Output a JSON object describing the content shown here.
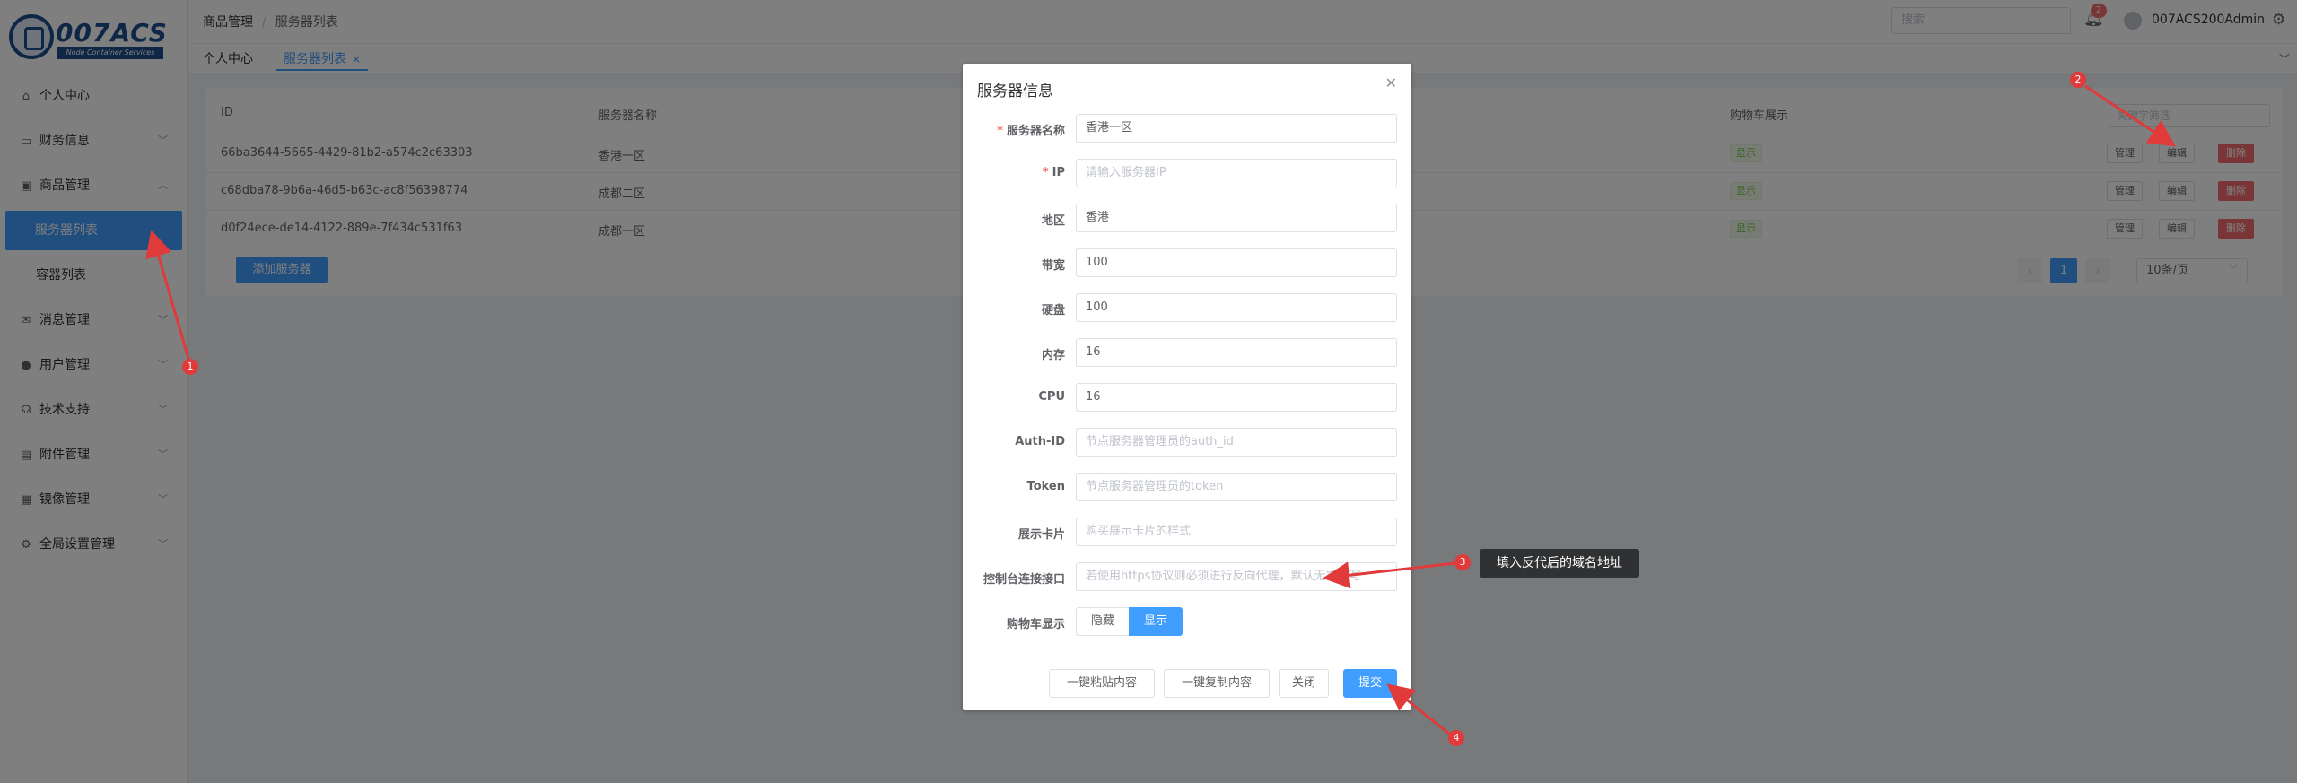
{
  "brand": {
    "logo_text": "007ACS",
    "logo_sub": "Node Container Services"
  },
  "sidebar": {
    "items": [
      {
        "label": "个人中心",
        "icon": "home-icon",
        "glyph": "⌂",
        "chevron": false
      },
      {
        "label": "财务信息",
        "icon": "wallet-icon",
        "glyph": "▭",
        "chevron": true
      },
      {
        "label": "商品管理",
        "icon": "bag-icon",
        "glyph": "▣",
        "chevron": true,
        "expanded": true
      },
      {
        "label": "消息管理",
        "icon": "message-icon",
        "glyph": "✉",
        "chevron": true
      },
      {
        "label": "用户管理",
        "icon": "user-icon",
        "glyph": "●",
        "chevron": true
      },
      {
        "label": "技术支持",
        "icon": "headset-icon",
        "glyph": "☊",
        "chevron": true
      },
      {
        "label": "附件管理",
        "icon": "folder-icon",
        "glyph": "▤",
        "chevron": true
      },
      {
        "label": "镜像管理",
        "icon": "box-icon",
        "glyph": "▦",
        "chevron": true
      },
      {
        "label": "全局设置管理",
        "icon": "settings-icon",
        "glyph": "⚙",
        "chevron": true
      }
    ],
    "sub_items": [
      "服务器列表",
      "容器列表"
    ]
  },
  "header": {
    "breadcrumb": [
      "商品管理",
      "服务器列表"
    ],
    "breadcrumb_sep": "/",
    "search_placeholder": "搜索",
    "notif_count": "2",
    "user_name": "007ACS200Admin"
  },
  "tabs": [
    {
      "label": "个人中心"
    },
    {
      "label": "服务器列表",
      "close": "×"
    }
  ],
  "table": {
    "headers": {
      "id": "ID",
      "name": "服务器名称",
      "cart": "购物车展示"
    },
    "filter_placeholder": "关键字筛选",
    "rows": [
      {
        "id": "66ba3644-5665-4429-81b2-a574c2c63303",
        "name": "香港一区",
        "cart": "显示"
      },
      {
        "id": "c68dba78-9b6a-46d5-b63c-ac8f56398774",
        "name": "成都二区",
        "cart": "显示"
      },
      {
        "id": "d0f24ece-de14-4122-889e-7f434c531f63",
        "name": "成都一区",
        "cart": "显示"
      }
    ],
    "actions": {
      "manage": "管理",
      "edit": "编辑",
      "delete": "删除"
    },
    "add_button": "添加服务器",
    "pager": {
      "current": "1",
      "size": "10条/页"
    }
  },
  "dialog": {
    "title": "服务器信息",
    "fields": [
      {
        "label": "服务器名称",
        "required": true,
        "value": "香港一区",
        "placeholder": ""
      },
      {
        "label": "IP",
        "required": true,
        "value": "",
        "placeholder": "请输入服务器IP"
      },
      {
        "label": "地区",
        "required": false,
        "value": "香港",
        "placeholder": ""
      },
      {
        "label": "带宽",
        "required": false,
        "value": "100",
        "placeholder": ""
      },
      {
        "label": "硬盘",
        "required": false,
        "value": "100",
        "placeholder": ""
      },
      {
        "label": "内存",
        "required": false,
        "value": "16",
        "placeholder": ""
      },
      {
        "label": "CPU",
        "required": false,
        "value": "16",
        "placeholder": ""
      },
      {
        "label": "Auth-ID",
        "required": false,
        "value": "",
        "placeholder": "节点服务器管理员的auth_id"
      },
      {
        "label": "Token",
        "required": false,
        "value": "",
        "placeholder": "节点服务器管理员的token"
      },
      {
        "label": "展示卡片",
        "required": false,
        "value": "",
        "placeholder": "购买展示卡片的样式"
      },
      {
        "label": "控制台连接接口",
        "required": false,
        "value": "",
        "placeholder": "若使用https协议则必须进行反向代理，默认无需填写"
      }
    ],
    "cart_label": "购物车显示",
    "cart_options": {
      "off": "隐藏",
      "on": "显示"
    },
    "buttons": {
      "paste": "一键粘贴内容",
      "copy": "一键复制内容",
      "close": "关闭",
      "submit": "提交"
    }
  },
  "annotations": {
    "markers": [
      "1",
      "2",
      "3",
      "4"
    ],
    "tooltip": "填入反代后的域名地址",
    "arrow_color": "#e03a3a"
  }
}
